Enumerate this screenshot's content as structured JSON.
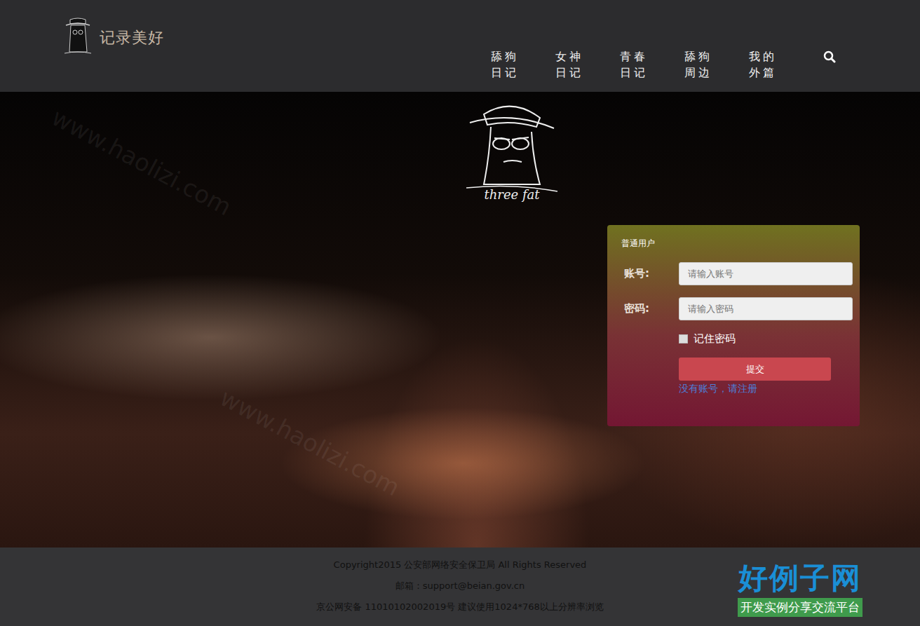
{
  "header": {
    "brand": "记录美好",
    "nav": [
      {
        "label": "舔狗日记",
        "selected": false
      },
      {
        "label": "女神日记",
        "selected": false
      },
      {
        "label": "青春日记",
        "selected": false
      },
      {
        "label": "舔狗周边",
        "selected": false
      },
      {
        "label": "我的外篇",
        "selected": false
      }
    ]
  },
  "hero": {
    "logo_caption": "three fat"
  },
  "login": {
    "title": "普通用户",
    "fields": [
      {
        "label": "账号:",
        "placeholder": "请输入账号",
        "type": "text"
      },
      {
        "label": "密码:",
        "placeholder": "请输入密码",
        "type": "password"
      }
    ],
    "remember": {
      "label": "记住密码",
      "checked": false
    },
    "submit": "提交",
    "register_link": "没有账号，请注册"
  },
  "footer": {
    "lines": [
      "Copyright2015 公安部网络安全保卫局 All Rights Reserved",
      "邮箱：support@beian.gov.cn",
      "京公网安备 11010102002019号 建议使用1024*768以上分辨率浏览"
    ]
  },
  "watermark": {
    "brand": "好例子网",
    "slogan": "开发实例分享交流平台",
    "url": "www.haolizi.com"
  }
}
